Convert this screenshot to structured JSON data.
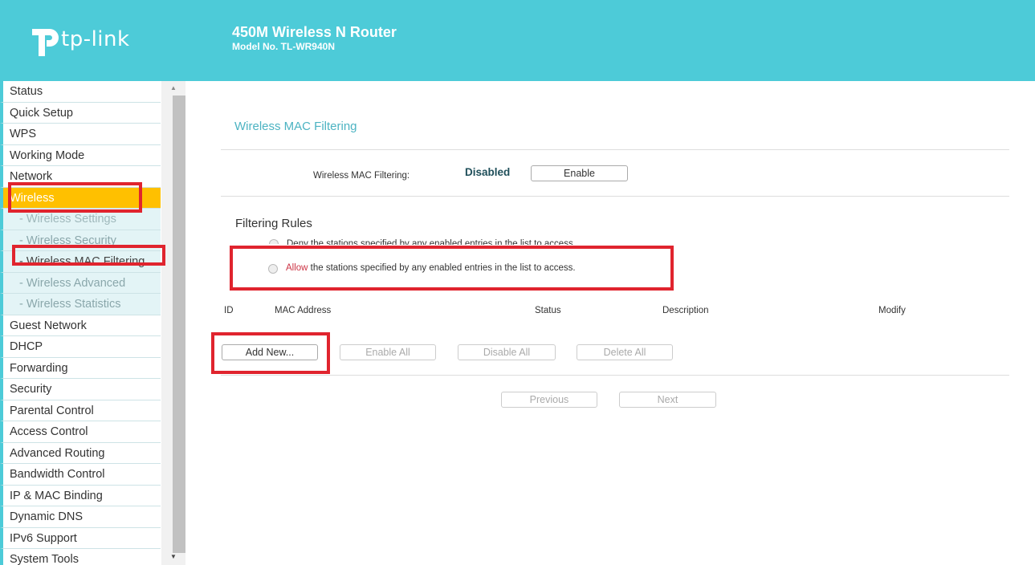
{
  "header": {
    "logo_text": "tp-link",
    "product_name": "450M Wireless N Router",
    "model_no": "Model No. TL-WR940N"
  },
  "sidebar": {
    "items": [
      {
        "label": "Status"
      },
      {
        "label": "Quick Setup"
      },
      {
        "label": "WPS"
      },
      {
        "label": "Working Mode"
      },
      {
        "label": "Network"
      },
      {
        "label": "Wireless"
      },
      {
        "label": "- Wireless Settings"
      },
      {
        "label": "- Wireless Security"
      },
      {
        "label": "- Wireless MAC Filtering"
      },
      {
        "label": "- Wireless Advanced"
      },
      {
        "label": "- Wireless Statistics"
      },
      {
        "label": "Guest Network"
      },
      {
        "label": "DHCP"
      },
      {
        "label": "Forwarding"
      },
      {
        "label": "Security"
      },
      {
        "label": "Parental Control"
      },
      {
        "label": "Access Control"
      },
      {
        "label": "Advanced Routing"
      },
      {
        "label": "Bandwidth Control"
      },
      {
        "label": "IP & MAC Binding"
      },
      {
        "label": "Dynamic DNS"
      },
      {
        "label": "IPv6 Support"
      },
      {
        "label": "System Tools"
      }
    ]
  },
  "main": {
    "title": "Wireless MAC Filtering",
    "mac_filter_label": "Wireless MAC Filtering:",
    "mac_filter_status": "Disabled",
    "enable_button": "Enable",
    "filtering_rules_title": "Filtering Rules",
    "deny_text": "Deny the stations specified by any enabled entries in the list to access.",
    "allow_word": "Allow",
    "allow_rest": " the stations specified by any enabled entries in the list to access.",
    "columns": [
      "ID",
      "MAC Address",
      "Status",
      "Description",
      "Modify"
    ],
    "buttons": {
      "add_new": "Add New...",
      "enable_all": "Enable All",
      "disable_all": "Disable All",
      "delete_all": "Delete All",
      "previous": "Previous",
      "next": "Next"
    }
  },
  "colors": {
    "header": "#4dcbd8",
    "active_nav": "#ffc000",
    "highlight": "#e0242e",
    "title": "#4cb3c2"
  }
}
